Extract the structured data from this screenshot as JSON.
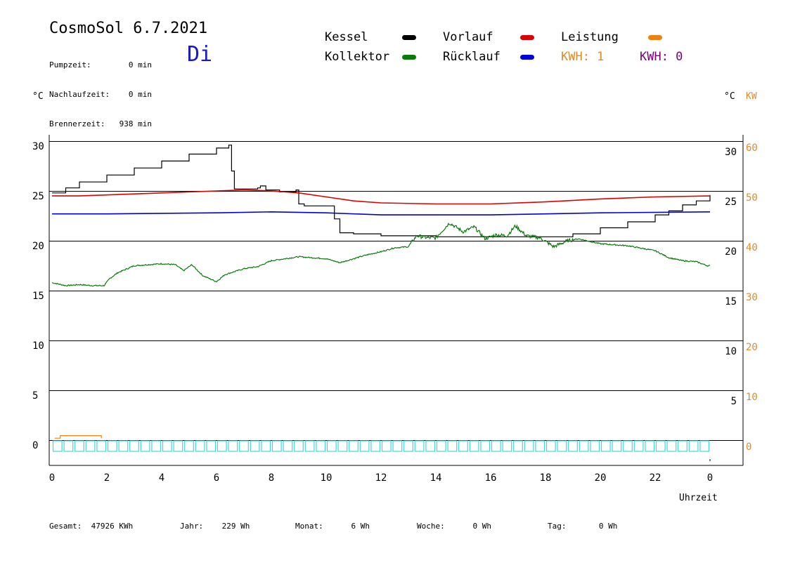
{
  "header": {
    "title": "CosmoSol 6.7.2021",
    "weekday": "Di",
    "info": [
      {
        "label": "Pumpzeit:",
        "value": "0 min"
      },
      {
        "label": "Nachlaufzeit:",
        "value": "0 min"
      },
      {
        "label": "Brennerzeit:",
        "value": "938 min"
      }
    ]
  },
  "legend": {
    "kessel": "Kessel",
    "kollektor": "Kollektor",
    "vorlauf": "Vorlauf",
    "ruecklauf": "Rücklauf",
    "leistung": "Leistung",
    "kwh1": "KWH: 1",
    "kwh2": "KWH: 0"
  },
  "colors": {
    "kessel": "#000000",
    "kollektor": "#0a7a0a",
    "vorlauf": "#dd0000",
    "ruecklauf": "#0000dd",
    "leistung": "#f08010",
    "kwh1": "#e08a2a",
    "kwh2": "#800080",
    "pump": "#40d8e0",
    "weekday": "#1a1acc"
  },
  "units": {
    "left": "°C",
    "right_temp": "°C",
    "right_power": "KW"
  },
  "footer": [
    {
      "label": "Gesamt:",
      "value": "47926 KWh"
    },
    {
      "label": "Jahr:",
      "value": "229 Wh"
    },
    {
      "label": "Monat:",
      "value": "6 Wh"
    },
    {
      "label": "Woche:",
      "value": "0 Wh"
    },
    {
      "label": "Tag:",
      "value": "0 Wh"
    }
  ],
  "chart_data": {
    "type": "line",
    "xlabel": "Uhrzeit",
    "x_ticks": [
      "0",
      "2",
      "4",
      "6",
      "8",
      "10",
      "12",
      "14",
      "16",
      "18",
      "20",
      "22",
      "0"
    ],
    "x_range": [
      0,
      24
    ],
    "y_left_ticks": [
      "0",
      "5",
      "10",
      "15",
      "20",
      "25",
      "30"
    ],
    "y_right_temp_ticks": [
      "5",
      "10",
      "15",
      "20",
      "25",
      "30"
    ],
    "y_right_power_ticks": [
      "0",
      "10",
      "20",
      "30",
      "40",
      "50",
      "60"
    ],
    "ylim_temp": [
      0,
      30
    ],
    "ylim_power": [
      0,
      60
    ],
    "grid": "horizontal",
    "legend_position": "top",
    "series": [
      {
        "name": "Kessel",
        "color": "#000000",
        "step": true,
        "points": [
          [
            0,
            24.8
          ],
          [
            0.5,
            25.3
          ],
          [
            1,
            25.9
          ],
          [
            2,
            26.6
          ],
          [
            3,
            27.3
          ],
          [
            4,
            28.0
          ],
          [
            5,
            28.7
          ],
          [
            6,
            29.3
          ],
          [
            6.45,
            29.6
          ],
          [
            6.55,
            27.0
          ],
          [
            6.65,
            25.2
          ],
          [
            7,
            25.2
          ],
          [
            7.5,
            25.3
          ],
          [
            7.6,
            25.5
          ],
          [
            7.8,
            25.1
          ],
          [
            8.3,
            24.9
          ],
          [
            8.9,
            25.1
          ],
          [
            9.0,
            23.7
          ],
          [
            9.2,
            23.5
          ],
          [
            10.2,
            23.5
          ],
          [
            10.3,
            22.2
          ],
          [
            10.5,
            20.8
          ],
          [
            11,
            20.7
          ],
          [
            12,
            20.5
          ],
          [
            14,
            20.4
          ],
          [
            18,
            20.4
          ],
          [
            18.8,
            20.4
          ],
          [
            19,
            20.7
          ],
          [
            20,
            21.3
          ],
          [
            21,
            21.9
          ],
          [
            22,
            22.6
          ],
          [
            22.5,
            23.0
          ],
          [
            23,
            23.6
          ],
          [
            23.5,
            24.0
          ],
          [
            24,
            24.6
          ]
        ]
      },
      {
        "name": "Vorlauf",
        "color": "#dd0000",
        "points": [
          [
            0,
            24.5
          ],
          [
            1,
            24.5
          ],
          [
            2,
            24.6
          ],
          [
            4,
            24.8
          ],
          [
            6,
            25.0
          ],
          [
            7,
            25.1
          ],
          [
            8,
            25.0
          ],
          [
            9,
            24.8
          ],
          [
            10,
            24.4
          ],
          [
            11,
            24.0
          ],
          [
            12,
            23.8
          ],
          [
            14,
            23.7
          ],
          [
            16,
            23.7
          ],
          [
            18,
            23.9
          ],
          [
            20,
            24.2
          ],
          [
            22,
            24.4
          ],
          [
            24,
            24.5
          ]
        ]
      },
      {
        "name": "Rücklauf",
        "color": "#0000dd",
        "points": [
          [
            0,
            22.7
          ],
          [
            2,
            22.7
          ],
          [
            6,
            22.8
          ],
          [
            8,
            22.9
          ],
          [
            10,
            22.8
          ],
          [
            12,
            22.6
          ],
          [
            16,
            22.6
          ],
          [
            18,
            22.7
          ],
          [
            20,
            22.8
          ],
          [
            24,
            22.9
          ]
        ]
      },
      {
        "name": "Kollektor",
        "color": "#0a7a0a",
        "noisy": true,
        "points": [
          [
            0,
            15.8
          ],
          [
            0.5,
            15.5
          ],
          [
            1,
            15.6
          ],
          [
            1.5,
            15.5
          ],
          [
            1.9,
            15.5
          ],
          [
            2.1,
            16.2
          ],
          [
            2.4,
            16.8
          ],
          [
            3,
            17.5
          ],
          [
            4,
            17.7
          ],
          [
            4.5,
            17.6
          ],
          [
            4.8,
            17.0
          ],
          [
            5.1,
            17.6
          ],
          [
            5.5,
            16.5
          ],
          [
            6,
            15.9
          ],
          [
            6.3,
            16.6
          ],
          [
            7,
            17.2
          ],
          [
            7.5,
            17.4
          ],
          [
            8,
            18.0
          ],
          [
            9,
            18.4
          ],
          [
            10,
            18.2
          ],
          [
            10.5,
            17.8
          ],
          [
            11.5,
            18.6
          ],
          [
            12,
            18.9
          ],
          [
            12.5,
            19.3
          ],
          [
            13,
            19.4
          ],
          [
            13.3,
            20.5
          ],
          [
            13.7,
            20.3
          ],
          [
            14,
            20.3
          ],
          [
            14.5,
            21.8
          ],
          [
            15,
            20.9
          ],
          [
            15.4,
            21.4
          ],
          [
            15.8,
            20.2
          ],
          [
            16.2,
            20.6
          ],
          [
            16.6,
            20.5
          ],
          [
            16.9,
            21.5
          ],
          [
            17.3,
            20.5
          ],
          [
            17.8,
            20.3
          ],
          [
            18.3,
            19.4
          ],
          [
            18.8,
            20.0
          ],
          [
            19.2,
            20.2
          ],
          [
            20,
            19.7
          ],
          [
            21,
            19.5
          ],
          [
            22,
            19.0
          ],
          [
            22.5,
            18.3
          ],
          [
            23,
            18.0
          ],
          [
            23.5,
            17.9
          ],
          [
            23.9,
            17.5
          ],
          [
            24,
            17.5
          ]
        ]
      },
      {
        "name": "Leistung",
        "color": "#f08010",
        "points": [
          [
            0.1,
            0.4
          ],
          [
            0.3,
            0.4
          ],
          [
            0.3,
            0.9
          ],
          [
            1.8,
            0.9
          ],
          [
            1.8,
            0.4
          ]
        ]
      }
    ],
    "pump_axis": {
      "color": "#40d8e0",
      "segments": 60
    }
  }
}
